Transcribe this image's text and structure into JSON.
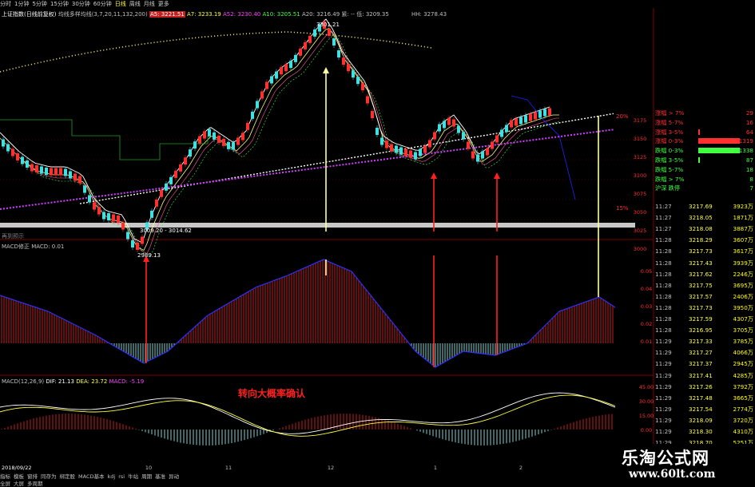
{
  "toolbar": {
    "items": [
      "分时",
      "1分钟",
      "5分钟",
      "15分钟",
      "30分钟",
      "60分钟",
      "日线",
      "周线",
      "月线",
      "更多"
    ]
  },
  "main_header": {
    "title": "上证指数(日线前复权)",
    "indicator": "均线多样均线(3,7,20,11,132,200)",
    "a5": "A5: 3221.51",
    "a7": "A7: 3233.19",
    "a52": "A52: 3230.40",
    "a10": "A10: 3205.51",
    "a20": "A20: 3216.49",
    "extra": "紧: -- 低: 3209.35",
    "hh": "HH: 3278.43"
  },
  "macd_top_header": {
    "label": "MACD修正  MACD: 0.01"
  },
  "macd_bottom_header": {
    "label": "MACD(12,26,9)",
    "dif": "DIF: 21.13",
    "dea": "DEA: 23.72",
    "macd": "MACD: -5.19"
  },
  "annotations": {
    "top_price": "3301.21",
    "low_price": "2989.13",
    "range_label": "3009.20 - 3014.62",
    "pct_top": "20%",
    "pct_bottom": "15%",
    "chart_note": "转向大概率确认",
    "left_hint": "再到预示"
  },
  "chart_data": {
    "type": "candlestick",
    "price_axis": [
      "3175",
      "3150",
      "3125",
      "3100",
      "3075",
      "3050",
      "3025",
      "3000"
    ],
    "macd_top_axis": [
      "0.05",
      "0.04",
      "0.03",
      "0.02",
      "0.01"
    ],
    "macd_bottom_axis": [
      "45.00",
      "30.00",
      "15.00",
      "0.00"
    ],
    "x_ticks": [
      "10",
      "11",
      "12",
      "1",
      "2"
    ],
    "date_label": "2018/09/22",
    "last_values": {
      "dif": 21.13,
      "dea": 23.72,
      "macd": -5.19
    }
  },
  "right_panel": {
    "distribution": [
      {
        "label": "涨幅 > 7%",
        "value": "29",
        "bar": 0
      },
      {
        "label": "涨幅 5-7%",
        "value": "16",
        "bar": 0
      },
      {
        "label": "涨幅 3-5%",
        "value": "64",
        "bar": 0.04
      },
      {
        "label": "涨幅 0-3%",
        "value": "1319",
        "bar": 1
      },
      {
        "label": "跌幅 0-3%",
        "value": "1338",
        "bar": 1
      },
      {
        "label": "跌幅 3-5%",
        "value": "87",
        "bar": 0.04
      },
      {
        "label": "跌幅 5-7%",
        "value": "18",
        "bar": 0
      },
      {
        "label": "跌幅 > 7%",
        "value": "8",
        "bar": 0
      },
      {
        "label": "沪深 跌停",
        "value": "7",
        "bar": 0
      }
    ],
    "ticks": [
      {
        "time": "11:27",
        "price": "3217.69",
        "vol": "3923万"
      },
      {
        "time": "11:27",
        "price": "3218.05",
        "vol": "1871万"
      },
      {
        "time": "11:27",
        "price": "3218.08",
        "vol": "3887万"
      },
      {
        "time": "11:28",
        "price": "3218.29",
        "vol": "3607万"
      },
      {
        "time": "11:28",
        "price": "3217.73",
        "vol": "3617万"
      },
      {
        "time": "11:28",
        "price": "3217.43",
        "vol": "3939万"
      },
      {
        "time": "11:28",
        "price": "3217.62",
        "vol": "2246万"
      },
      {
        "time": "11:28",
        "price": "3217.75",
        "vol": "3695万"
      },
      {
        "time": "11:28",
        "price": "3217.57",
        "vol": "2406万"
      },
      {
        "time": "11:28",
        "price": "3217.73",
        "vol": "3950万"
      },
      {
        "time": "11:28",
        "price": "3217.59",
        "vol": "4307万"
      },
      {
        "time": "11:28",
        "price": "3216.95",
        "vol": "3705万"
      },
      {
        "time": "11:29",
        "price": "3217.33",
        "vol": "3785万"
      },
      {
        "time": "11:29",
        "price": "3217.27",
        "vol": "4066万"
      },
      {
        "time": "11:29",
        "price": "3217.37",
        "vol": "2945万"
      },
      {
        "time": "11:29",
        "price": "3217.41",
        "vol": "4285万"
      },
      {
        "time": "11:29",
        "price": "3217.26",
        "vol": "3792万"
      },
      {
        "time": "11:29",
        "price": "3217.48",
        "vol": "3665万"
      },
      {
        "time": "11:29",
        "price": "3217.54",
        "vol": "2774万"
      },
      {
        "time": "11:29",
        "price": "3218.09",
        "vol": "3720万"
      },
      {
        "time": "11:29",
        "price": "3218.30",
        "vol": "4310万"
      },
      {
        "time": "11:29",
        "price": "3218.70",
        "vol": "5251万"
      },
      {
        "time": "11:29",
        "price": "3218.45",
        "vol": "5573万"
      }
    ]
  },
  "bottom_bar": {
    "row1": [
      "指标",
      "模板",
      "窗排",
      "同存为",
      "绑定股",
      "MACD基本",
      "kdj",
      "rsi",
      "牛站",
      "周期",
      "基准",
      "异动"
    ],
    "row2": [
      "全屏",
      "大屏",
      "多周期"
    ]
  },
  "watermark": {
    "cn": "乐淘公式网",
    "url": "www.60lt.com"
  },
  "colors": {
    "up": "#ff3030",
    "down": "#40e0e0",
    "yellow": "#ffff80",
    "white": "#ffffff",
    "magenta": "#d040ff",
    "green": "#40ff40",
    "blue": "#4040ff",
    "panel_num": "#ffff40",
    "panel_vol": "#ffff00"
  }
}
